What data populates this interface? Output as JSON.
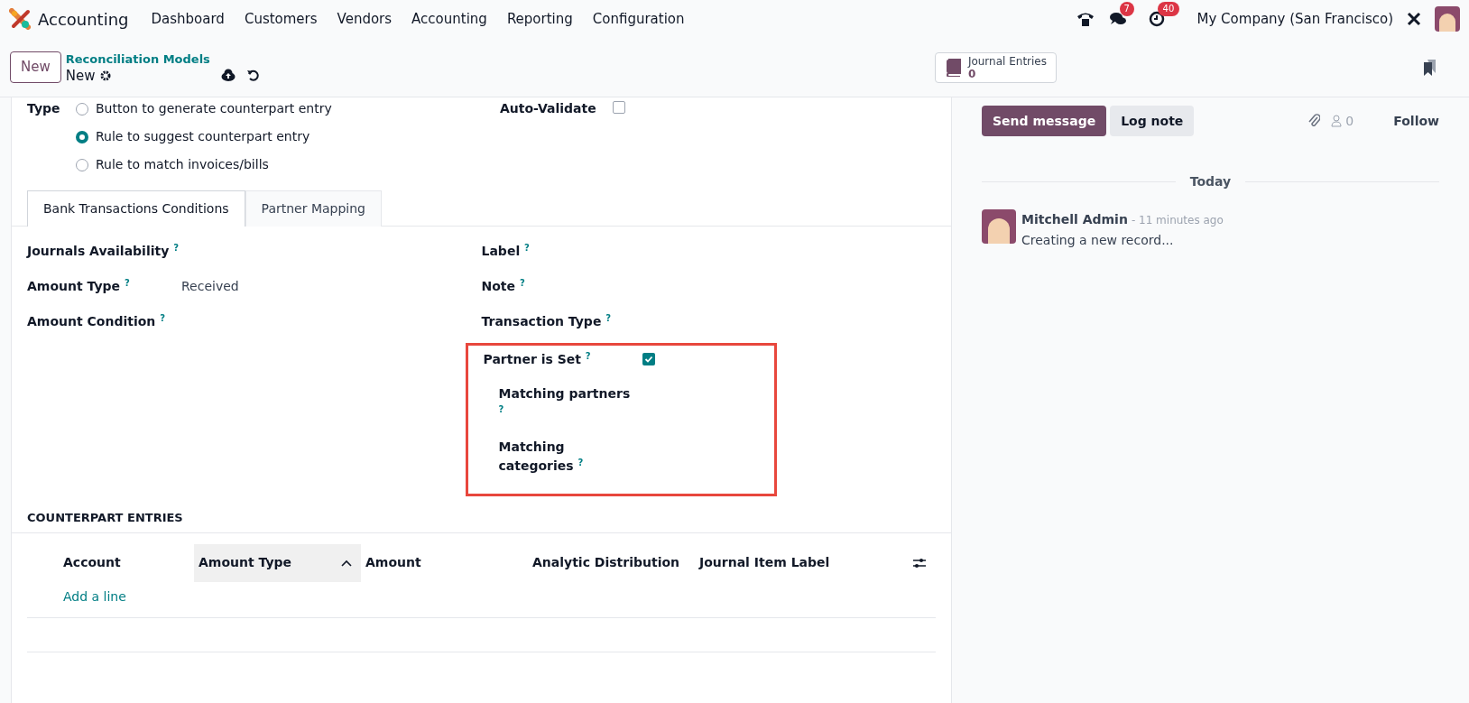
{
  "navbar": {
    "app_name": "Accounting",
    "menu": [
      "Dashboard",
      "Customers",
      "Vendors",
      "Accounting",
      "Reporting",
      "Configuration"
    ],
    "messages_badge": "7",
    "activities_badge": "40",
    "company": "My Company (San Francisco)"
  },
  "control_panel": {
    "new_button": "New",
    "breadcrumb": "Reconciliation Models",
    "record_name": "New",
    "smart_button": {
      "label": "Journal Entries",
      "value": "0"
    }
  },
  "form": {
    "type_label": "Type",
    "auto_validate_label": "Auto-Validate",
    "auto_validate_checked": false,
    "type_options": [
      {
        "label": "Button to generate counterpart entry",
        "selected": false
      },
      {
        "label": "Rule to suggest counterpart entry",
        "selected": true
      },
      {
        "label": "Rule to match invoices/bills",
        "selected": false
      }
    ],
    "tabs": [
      {
        "label": "Bank Transactions Conditions",
        "selected": true
      },
      {
        "label": "Partner Mapping",
        "selected": false
      }
    ],
    "left_fields": [
      {
        "label": "Journals Availability",
        "help": "?"
      },
      {
        "label": "Amount Type",
        "help": "?",
        "value": "Received"
      },
      {
        "label": "Amount Condition",
        "help": "?"
      }
    ],
    "right_fields": [
      {
        "label": "Label",
        "help": "?"
      },
      {
        "label": "Note",
        "help": "?"
      },
      {
        "label": "Transaction Type",
        "help": "?"
      }
    ],
    "partner_group": {
      "label": "Partner is Set",
      "help": "?",
      "checked": true,
      "highlighted": true,
      "children": [
        {
          "label": "Matching partners",
          "help": "?"
        },
        {
          "label": "Matching categories",
          "help": "?"
        }
      ]
    },
    "counterpart": {
      "title": "COUNTERPART ENTRIES",
      "columns": [
        {
          "label": "Account",
          "sorted": false
        },
        {
          "label": "Amount Type",
          "sorted": true
        },
        {
          "label": "Amount",
          "sorted": false
        },
        {
          "label": "Analytic Distribution",
          "sorted": false
        },
        {
          "label": "Journal Item Label",
          "sorted": false
        }
      ],
      "add_line": "Add a line"
    }
  },
  "chatter": {
    "send_message": "Send message",
    "log_note": "Log note",
    "followers": "0",
    "follow": "Follow",
    "date_separator": "Today",
    "messages": [
      {
        "author": "Mitchell Admin",
        "time": "- 11 minutes ago",
        "body": "Creating a new record..."
      }
    ]
  }
}
